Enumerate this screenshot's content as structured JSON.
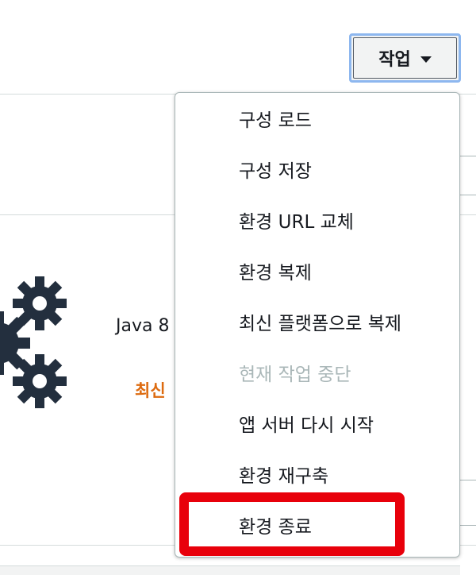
{
  "toolbar": {
    "actions_label": "작업"
  },
  "actions_menu": {
    "items": [
      {
        "label": "구성 로드",
        "enabled": true
      },
      {
        "label": "구성 저장",
        "enabled": true
      },
      {
        "label": "환경 URL 교체",
        "enabled": true
      },
      {
        "label": "환경 복제",
        "enabled": true
      },
      {
        "label": "최신 플랫폼으로 복제",
        "enabled": true
      },
      {
        "label": "현재 작업 중단",
        "enabled": false
      },
      {
        "label": "앱 서버 다시 시작",
        "enabled": true
      },
      {
        "label": "환경 재구축",
        "enabled": true
      },
      {
        "label": "환경 종료",
        "enabled": true,
        "highlighted": true
      }
    ]
  },
  "environment": {
    "platform_partial": "Java 8",
    "status_partial": "최신"
  },
  "colors": {
    "highlight": "#e8000b",
    "focus_ring": "#8db7ef",
    "status_orange": "#dd6b10",
    "disabled_text": "#aab7b8"
  }
}
